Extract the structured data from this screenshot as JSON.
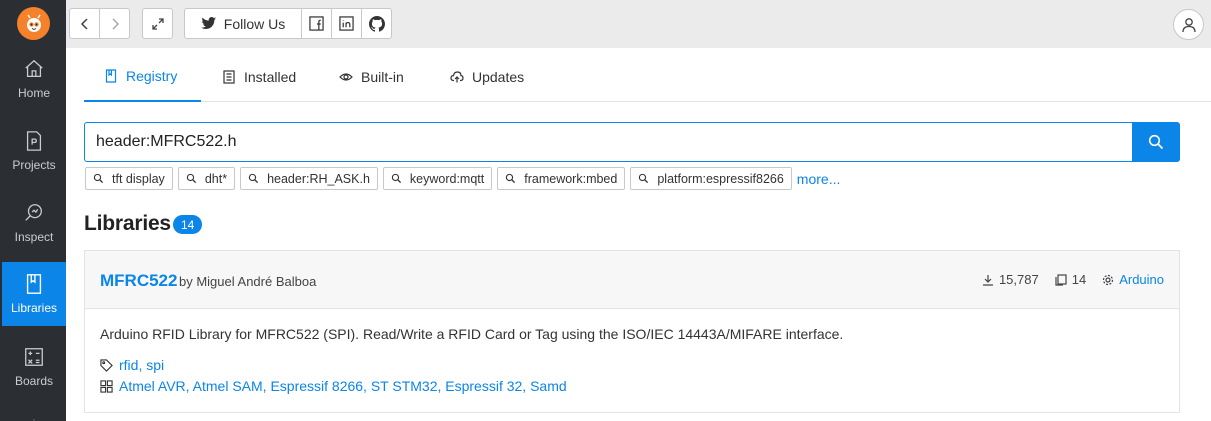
{
  "sidebar": {
    "items": [
      {
        "label": "Home",
        "icon": "home-icon"
      },
      {
        "label": "Projects",
        "icon": "project-file-icon"
      },
      {
        "label": "Inspect",
        "icon": "inspect-icon"
      },
      {
        "label": "Libraries",
        "icon": "book-icon"
      },
      {
        "label": "Boards",
        "icon": "calculator-icon"
      }
    ],
    "active": "Libraries"
  },
  "topbar": {
    "follow_label": "Follow Us"
  },
  "tabs": [
    {
      "label": "Registry",
      "icon": "book-icon",
      "active": true
    },
    {
      "label": "Installed",
      "icon": "list-icon",
      "active": false
    },
    {
      "label": "Built-in",
      "icon": "eye-icon",
      "active": false
    },
    {
      "label": "Updates",
      "icon": "cloud-upload-icon",
      "active": false
    }
  ],
  "search": {
    "value": "header:MFRC522.h",
    "suggestions": [
      "tft display",
      "dht*",
      "header:RH_ASK.h",
      "keyword:mqtt",
      "framework:mbed",
      "platform:espressif8266"
    ],
    "more_label": "more..."
  },
  "libraries": {
    "title": "Libraries",
    "count": "14"
  },
  "card": {
    "name": "MFRC522",
    "by": "by Miguel André Balboa",
    "downloads": "15,787",
    "examples": "14",
    "framework": "Arduino",
    "description": "Arduino RFID Library for MFRC522 (SPI). Read/Write a RFID Card or Tag using the ISO/IEC 14443A/MIFARE interface.",
    "keywords": "rfid, spi",
    "platforms": "Atmel AVR, Atmel SAM, Espressif 8266, ST STM32, Espressif 32, Samd"
  },
  "colors": {
    "accent": "#0b85e8",
    "sidebar": "#2b2f33",
    "logo": "#f5822a"
  }
}
